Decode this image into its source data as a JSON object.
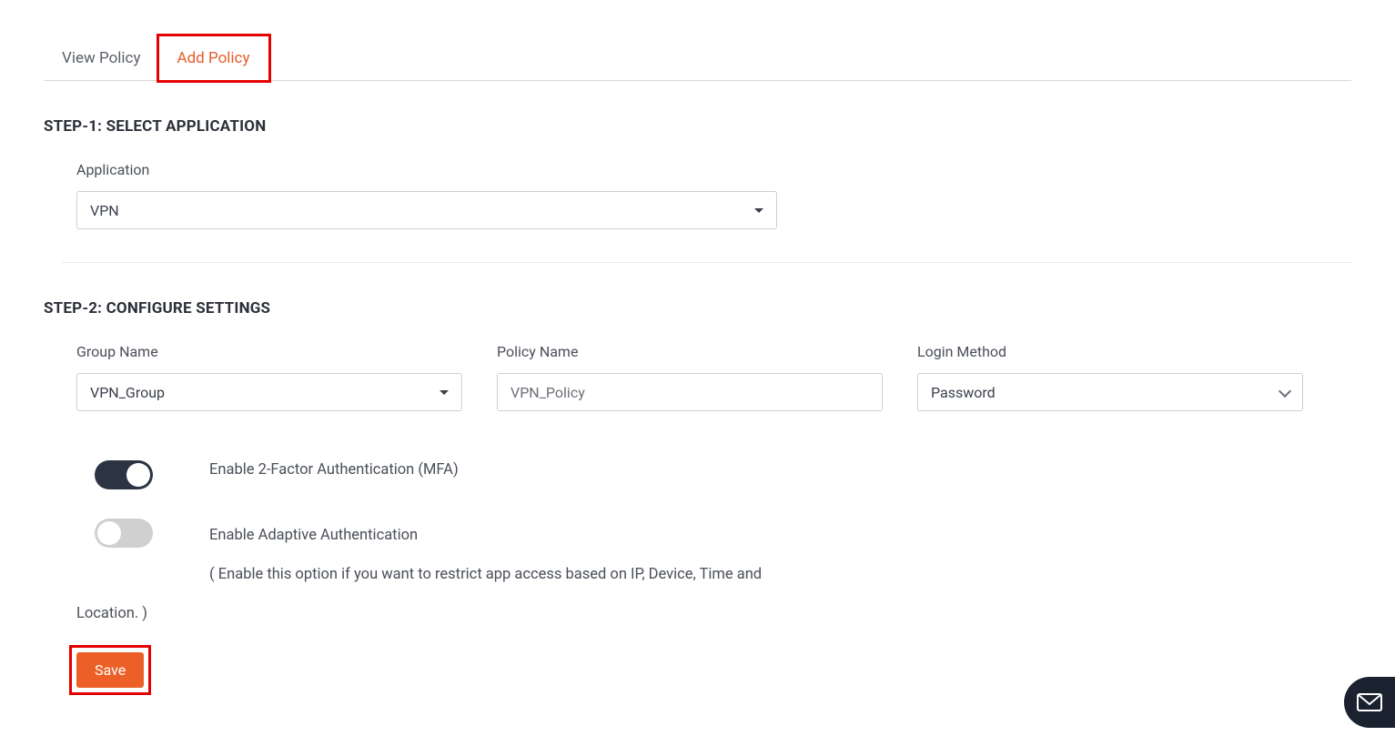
{
  "tabs": {
    "view": "View Policy",
    "add": "Add Policy"
  },
  "step1": {
    "heading": "STEP-1: SELECT APPLICATION",
    "application_label": "Application",
    "application_value": "VPN"
  },
  "step2": {
    "heading": "STEP-2: CONFIGURE SETTINGS",
    "group_name_label": "Group Name",
    "group_name_value": "VPN_Group",
    "policy_name_label": "Policy Name",
    "policy_name_value": "VPN_Policy",
    "login_method_label": "Login Method",
    "login_method_value": "Password"
  },
  "toggles": {
    "mfa_label": "Enable 2-Factor Authentication (MFA)",
    "adaptive_label": "Enable Adaptive Authentication",
    "adaptive_desc_part1": "( Enable this option if you want to restrict app access based on IP, Device, Time and",
    "adaptive_desc_part2": "Location. )"
  },
  "buttons": {
    "save": "Save"
  }
}
